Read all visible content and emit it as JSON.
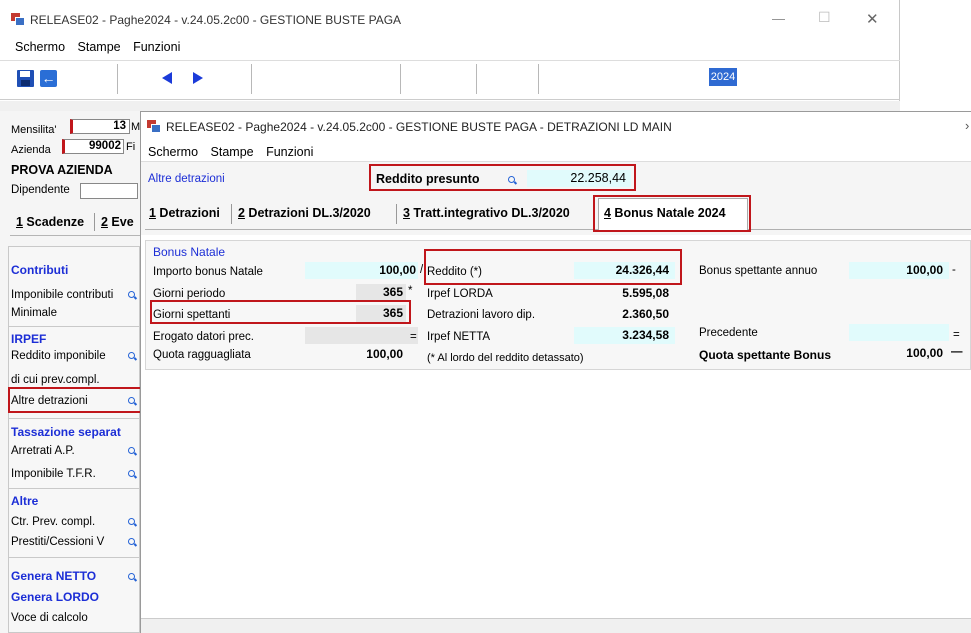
{
  "main_window": {
    "title": "RELEASE02 - Paghe2024 - v.24.05.2c00 - GESTIONE BUSTE PAGA",
    "menu": [
      "Schermo",
      "Stampe",
      "Funzioni"
    ],
    "year": "2024",
    "controls": {
      "minimize": "—",
      "maximize": "☐",
      "close": "✕"
    }
  },
  "left": {
    "mensilita_label": "Mensilita'",
    "mensilita_value": "13",
    "mensilita_suffix": "M",
    "azienda_label": "Azienda",
    "azienda_value": "99002",
    "azienda_suffix": "Fi",
    "company_name": "PROVA AZIENDA",
    "dipendente_label": "Dipendente",
    "tabs": [
      {
        "num": "1",
        "label": " Scadenze"
      },
      {
        "num": "2",
        "label": " Eve"
      }
    ],
    "contributi_title": "Contributi",
    "imponibile_contributi": "Imponibile contributi",
    "minimale": "Minimale",
    "irpef_title": "IRPEF",
    "reddito_imponibile": "Reddito imponibile",
    "di_cui_prev": "di cui prev.compl.",
    "altre_detrazioni": "Altre detrazioni",
    "tassazione_title": "Tassazione separat",
    "arretrati": "Arretrati A.P.",
    "imponibile_tfr": "Imponibile T.F.R.",
    "altre_title": "Altre",
    "ctr_prev": "Ctr. Prev. compl.",
    "prestiti": "Prestiti/Cessioni V",
    "genera_netto": "Genera NETTO",
    "genera_lordo": "Genera LORDO",
    "voce_calcolo": "Voce di calcolo"
  },
  "dialog": {
    "title": "RELEASE02 - Paghe2024 - v.24.05.2c00 - GESTIONE BUSTE PAGA - DETRAZIONI LD MAIN",
    "menu": [
      "Schermo",
      "Stampe",
      "Funzioni"
    ],
    "altre_detrazioni_link": "Altre detrazioni",
    "reddito_presunto_label": "Reddito presunto",
    "reddito_presunto_value": "22.258,44",
    "tabs": [
      {
        "num": "1",
        "label": " Detrazioni"
      },
      {
        "num": "2",
        "label": " Detrazioni DL.3/2020"
      },
      {
        "num": "3",
        "label": " Tratt.integrativo DL.3/2020"
      },
      {
        "num": "4",
        "label": " Bonus Natale 2024"
      }
    ],
    "bonus_group": "Bonus Natale",
    "importo_label": "Importo bonus Natale",
    "importo_value": "100,00",
    "importo_op": "/",
    "giorni_periodo_label": "Giorni periodo",
    "giorni_periodo_value": "365",
    "giorni_periodo_op": "*",
    "giorni_spettanti_label": "Giorni spettanti",
    "giorni_spettanti_value": "365",
    "erogato_label": "Erogato datori prec.",
    "erogato_op": "=",
    "quota_ragg_label": "Quota ragguagliata",
    "quota_ragg_value": "100,00",
    "reddito_label": "Reddito (*)",
    "reddito_value": "24.326,44",
    "irpef_lorda_label": "Irpef LORDA",
    "irpef_lorda_value": "5.595,08",
    "detrazioni_lavoro_label": "Detrazioni lavoro dip.",
    "detrazioni_lavoro_value": "2.360,50",
    "irpef_netta_label": "Irpef NETTA",
    "irpef_netta_value": "3.234,58",
    "footnote": "(* Al lordo del reddito detassato)",
    "bonus_annuo_label": "Bonus spettante annuo",
    "bonus_annuo_value": "100,00",
    "bonus_annuo_op": "-",
    "precedente_label": "Precedente",
    "precedente_op": "=",
    "quota_bonus_label": "Quota spettante Bonus",
    "quota_bonus_value": "100,00",
    "quota_bonus_op": "—"
  },
  "colors": {
    "highlight": "#c0161b",
    "field": "#e1fbfc",
    "accent": "#1c2ed6"
  }
}
